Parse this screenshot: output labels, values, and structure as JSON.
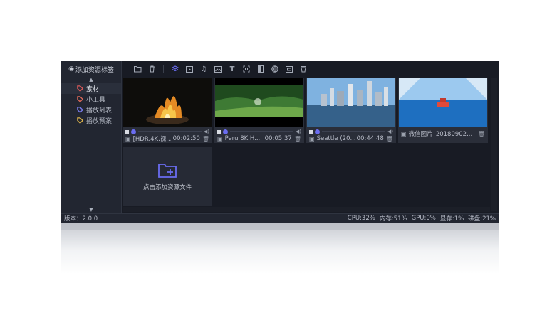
{
  "sidebar": {
    "header": "添加资源标签",
    "items": [
      {
        "label": "素材",
        "color": "#e05a5a",
        "active": true
      },
      {
        "label": "小工具",
        "color": "#e06a5a",
        "active": false
      },
      {
        "label": "播放列表",
        "color": "#7a7ef0",
        "active": false
      },
      {
        "label": "播放预案",
        "color": "#e0b54a",
        "active": false
      }
    ]
  },
  "toolbar": {
    "icons": [
      "add-folder-icon",
      "delete-icon",
      "layers-icon",
      "video-icon",
      "music-icon",
      "image-icon",
      "text-icon",
      "capture-icon",
      "document-icon",
      "web-icon",
      "media-icon",
      "stream-icon"
    ]
  },
  "media": [
    {
      "name": "[HDR.4K.视...",
      "duration": "00:02:50",
      "kind": "video",
      "thumb": "fire"
    },
    {
      "name": "Peru 8K H...",
      "duration": "00:05:37",
      "kind": "video",
      "thumb": "forest"
    },
    {
      "name": "Seattle (20...",
      "duration": "00:44:48",
      "kind": "video",
      "thumb": "city"
    },
    {
      "name": "微信图片_20180902...",
      "duration": "",
      "kind": "image",
      "thumb": "pool"
    }
  ],
  "add_resource": {
    "label": "点击添加资源文件"
  },
  "status": {
    "version": "版本：2.0.0",
    "cpu": "CPU:32%",
    "memory": "内存:51%",
    "gpu": "GPU:0%",
    "vram": "显存:1%",
    "disk": "磁盘:21%"
  },
  "colors": {
    "accent": "#6a6cf0",
    "background": "#181b24"
  }
}
